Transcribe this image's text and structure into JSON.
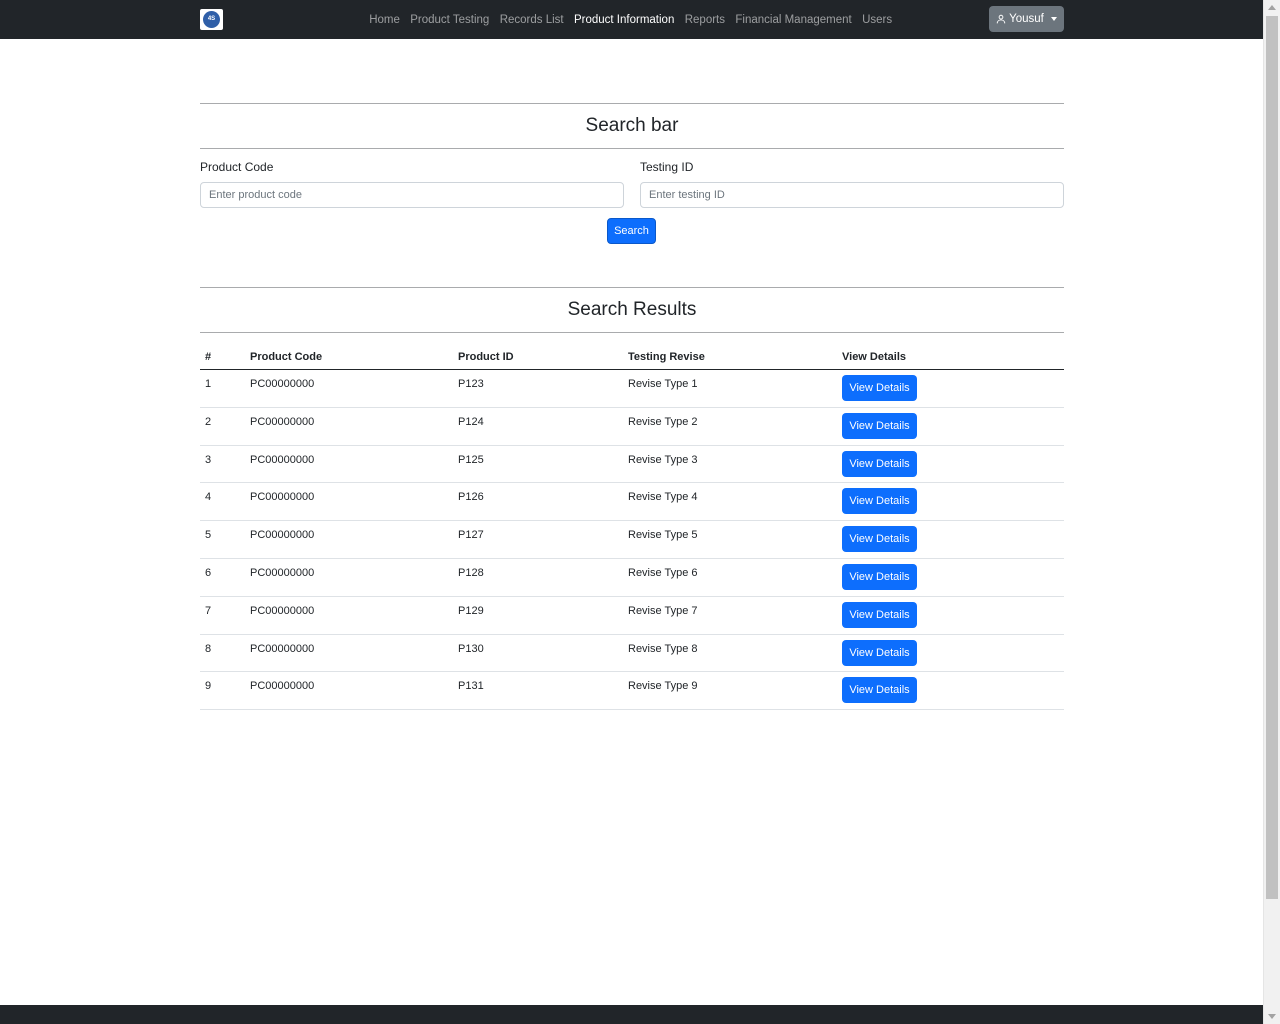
{
  "nav": {
    "logo_text": "4S",
    "links": [
      {
        "label": "Home",
        "active": false
      },
      {
        "label": "Product Testing",
        "active": false
      },
      {
        "label": "Records List",
        "active": false
      },
      {
        "label": "Product Information",
        "active": true
      },
      {
        "label": "Reports",
        "active": false
      },
      {
        "label": "Financial Management",
        "active": false
      },
      {
        "label": "Users",
        "active": false
      }
    ],
    "user_label": "Yousuf"
  },
  "search": {
    "title": "Search bar",
    "product_code_label": "Product Code",
    "product_code_placeholder": "Enter product code",
    "product_code_value": "",
    "testing_id_label": "Testing ID",
    "testing_id_placeholder": "Enter testing ID",
    "testing_id_value": "",
    "button_label": "Search"
  },
  "results": {
    "title": "Search Results",
    "columns": [
      "#",
      "Product Code",
      "Product ID",
      "Testing Revise",
      "View Details"
    ],
    "rows": [
      {
        "num": "1",
        "code": "PC00000000",
        "id": "P123",
        "revise": "Revise Type 1",
        "action": "View Details"
      },
      {
        "num": "2",
        "code": "PC00000000",
        "id": "P124",
        "revise": "Revise Type 2",
        "action": "View Details"
      },
      {
        "num": "3",
        "code": "PC00000000",
        "id": "P125",
        "revise": "Revise Type 3",
        "action": "View Details"
      },
      {
        "num": "4",
        "code": "PC00000000",
        "id": "P126",
        "revise": "Revise Type 4",
        "action": "View Details"
      },
      {
        "num": "5",
        "code": "PC00000000",
        "id": "P127",
        "revise": "Revise Type 5",
        "action": "View Details"
      },
      {
        "num": "6",
        "code": "PC00000000",
        "id": "P128",
        "revise": "Revise Type 6",
        "action": "View Details"
      },
      {
        "num": "7",
        "code": "PC00000000",
        "id": "P129",
        "revise": "Revise Type 7",
        "action": "View Details"
      },
      {
        "num": "8",
        "code": "PC00000000",
        "id": "P130",
        "revise": "Revise Type 8",
        "action": "View Details"
      },
      {
        "num": "9",
        "code": "PC00000000",
        "id": "P131",
        "revise": "Revise Type 9",
        "action": "View Details"
      }
    ]
  },
  "colors": {
    "navbar": "#212529",
    "primary": "#0d6efd",
    "secondary": "#6c757d"
  }
}
